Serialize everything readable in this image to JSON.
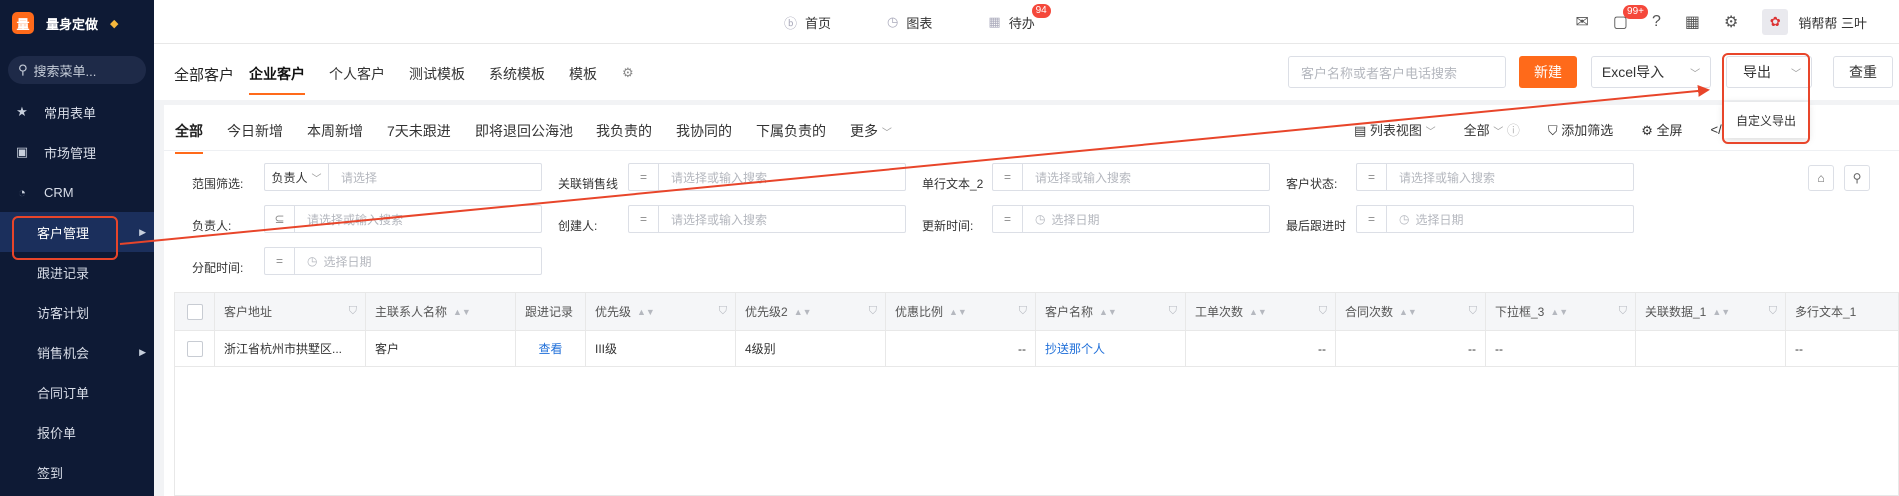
{
  "sidebar": {
    "brand_logo": "量",
    "brand_name": "量身定做",
    "search_placeholder": "搜索菜单...",
    "items": [
      {
        "label": "常用表单",
        "icon": "star-icon"
      },
      {
        "label": "市场管理",
        "icon": "clipboard-icon"
      },
      {
        "label": "CRM",
        "icon": "pie-chart-icon"
      }
    ],
    "sub_items": [
      {
        "label": "客户管理",
        "active": true
      },
      {
        "label": "跟进记录"
      },
      {
        "label": "访客计划"
      },
      {
        "label": "销售机会"
      },
      {
        "label": "合同订单"
      },
      {
        "label": "报价单"
      },
      {
        "label": "签到"
      }
    ]
  },
  "topbar": {
    "nav": [
      {
        "label": "首页",
        "icon": "home-icon"
      },
      {
        "label": "图表",
        "icon": "chart-icon"
      },
      {
        "label": "待办",
        "icon": "calendar-icon",
        "badge": "94"
      }
    ],
    "message_badge": "99+",
    "user_name": "销帮帮 三叶"
  },
  "tabs": {
    "title": "全部客户",
    "items": [
      "企业客户",
      "个人客户",
      "测试模板",
      "系统模板",
      "模板"
    ],
    "active": "企业客户",
    "search_placeholder": "客户名称或者客户电话搜索",
    "new_label": "新建",
    "excel_label": "Excel导入",
    "export_label": "导出",
    "dedupe_label": "查重"
  },
  "export_menu": {
    "item": "自定义导出"
  },
  "filter_tabs": {
    "items": [
      "全部",
      "今日新增",
      "本周新增",
      "7天未跟进",
      "即将退回公海池",
      "我负责的",
      "我协同的",
      "下属负责的",
      "更多"
    ],
    "view_label": "列表视图",
    "scope_label": "全部",
    "add_filter_label": "添加筛选",
    "fullscreen_label": "全屏"
  },
  "filters": {
    "scope_label": "范围筛选:",
    "scope_select": "负责人",
    "scope_placeholder": "请选择",
    "sales_line_label": "关联销售线",
    "single_text_label": "单行文本_2",
    "status_label": "客户状态:",
    "owner_label": "负责人:",
    "owner_placeholder": "请选择或输入搜索",
    "creator_label": "创建人:",
    "update_label": "更新时间:",
    "last_follow_label": "最后跟进时",
    "assign_label": "分配时间:",
    "search_placeholder": "请选择或输入搜索",
    "date_placeholder": "选择日期"
  },
  "table": {
    "columns": [
      "客户地址",
      "主联系人名称",
      "跟进记录",
      "优先级",
      "优先级2",
      "优惠比例",
      "客户名称",
      "工单次数",
      "合同次数",
      "下拉框_3",
      "关联数据_1",
      "多行文本_1"
    ],
    "rows": [
      {
        "address": "浙江省杭州市拱墅区...",
        "contact": "客户",
        "follow": "查看",
        "priority": "III级",
        "priority2": "4级别",
        "discount": "--",
        "name": "抄送那个人",
        "tickets": "--",
        "contracts": "--",
        "dropdown3": "--",
        "related1": "",
        "multiline1": "--"
      }
    ]
  },
  "colors": {
    "accent": "#ff6a1a",
    "annotation": "#e8452a",
    "sidebar_bg": "#0e1a35"
  }
}
